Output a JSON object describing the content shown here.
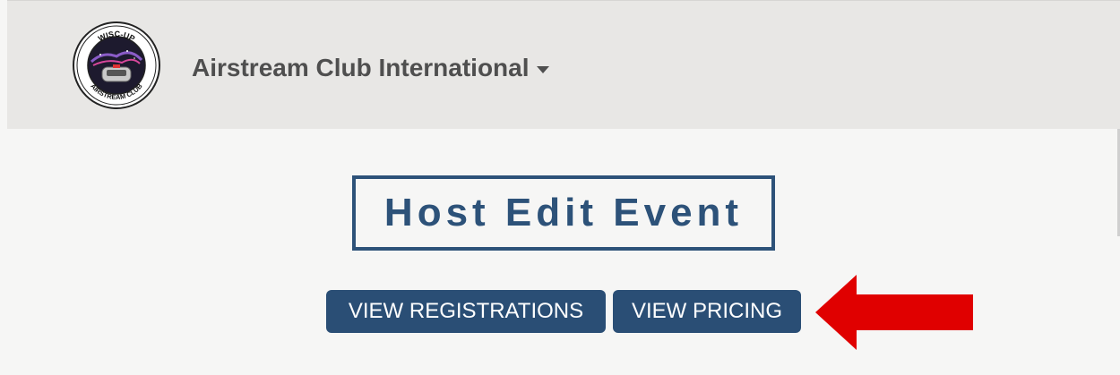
{
  "header": {
    "org_name": "Airstream Club International",
    "logo": {
      "top_text": "WISC-UP",
      "bottom_text": "AIRSTREAM CLUB",
      "icon": "club-logo"
    }
  },
  "main": {
    "title": "Host Edit Event",
    "buttons": {
      "view_registrations": "VIEW REGISTRATIONS",
      "view_pricing": "VIEW PRICING"
    },
    "annotation": {
      "icon": "red-arrow-icon",
      "color": "#e00000"
    }
  },
  "colors": {
    "header_bg": "#e8e7e5",
    "page_bg": "#f6f6f5",
    "primary": "#2a4e75",
    "brand_text": "#4f4f4f"
  }
}
